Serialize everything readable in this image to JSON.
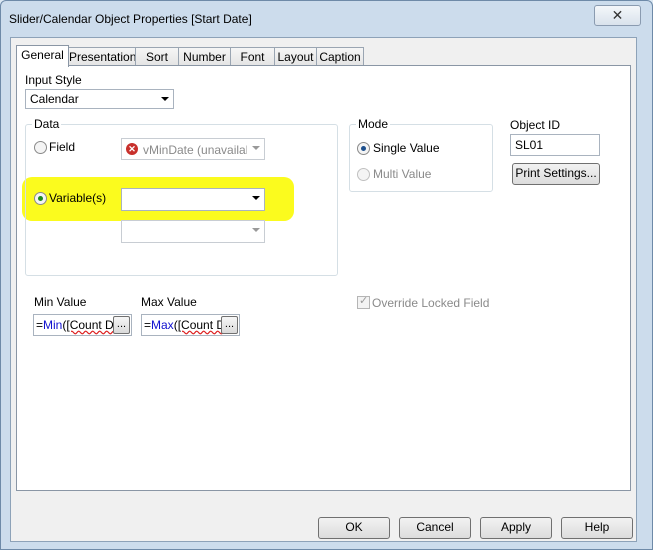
{
  "window": {
    "title": "Slider/Calendar Object Properties [Start Date]",
    "close_glyph": "✕"
  },
  "tabs": [
    {
      "label": "General",
      "active": true
    },
    {
      "label": "Presentation"
    },
    {
      "label": "Sort"
    },
    {
      "label": "Number"
    },
    {
      "label": "Font"
    },
    {
      "label": "Layout"
    },
    {
      "label": "Caption"
    }
  ],
  "input_style": {
    "label": "Input Style",
    "value": "Calendar"
  },
  "data_group": {
    "title": "Data",
    "field_label": "Field",
    "field_value": "vMinDate (unavailable",
    "variables_label": "Variable(s)",
    "variable1_value": "",
    "variable2_value": ""
  },
  "mode_group": {
    "title": "Mode",
    "single_value": "Single Value",
    "multi_value": "Multi Value"
  },
  "object_id": {
    "label": "Object ID",
    "value": "SL01",
    "print_settings": "Print Settings..."
  },
  "min_value": {
    "label": "Min Value",
    "eq": "=",
    "fn": "Min",
    "open": "(",
    "arg": "[Count D",
    "more": "..."
  },
  "max_value": {
    "label": "Max Value",
    "eq": "=",
    "fn": "Max",
    "open": "(",
    "arg": "[Count D",
    "more": "..."
  },
  "override_label": "Override Locked Field",
  "buttons": {
    "ok": "OK",
    "cancel": "Cancel",
    "apply": "Apply",
    "help": "Help"
  },
  "colors": {
    "highlight": "#fbfb1e",
    "radio_selected": "#1c8a1c"
  }
}
